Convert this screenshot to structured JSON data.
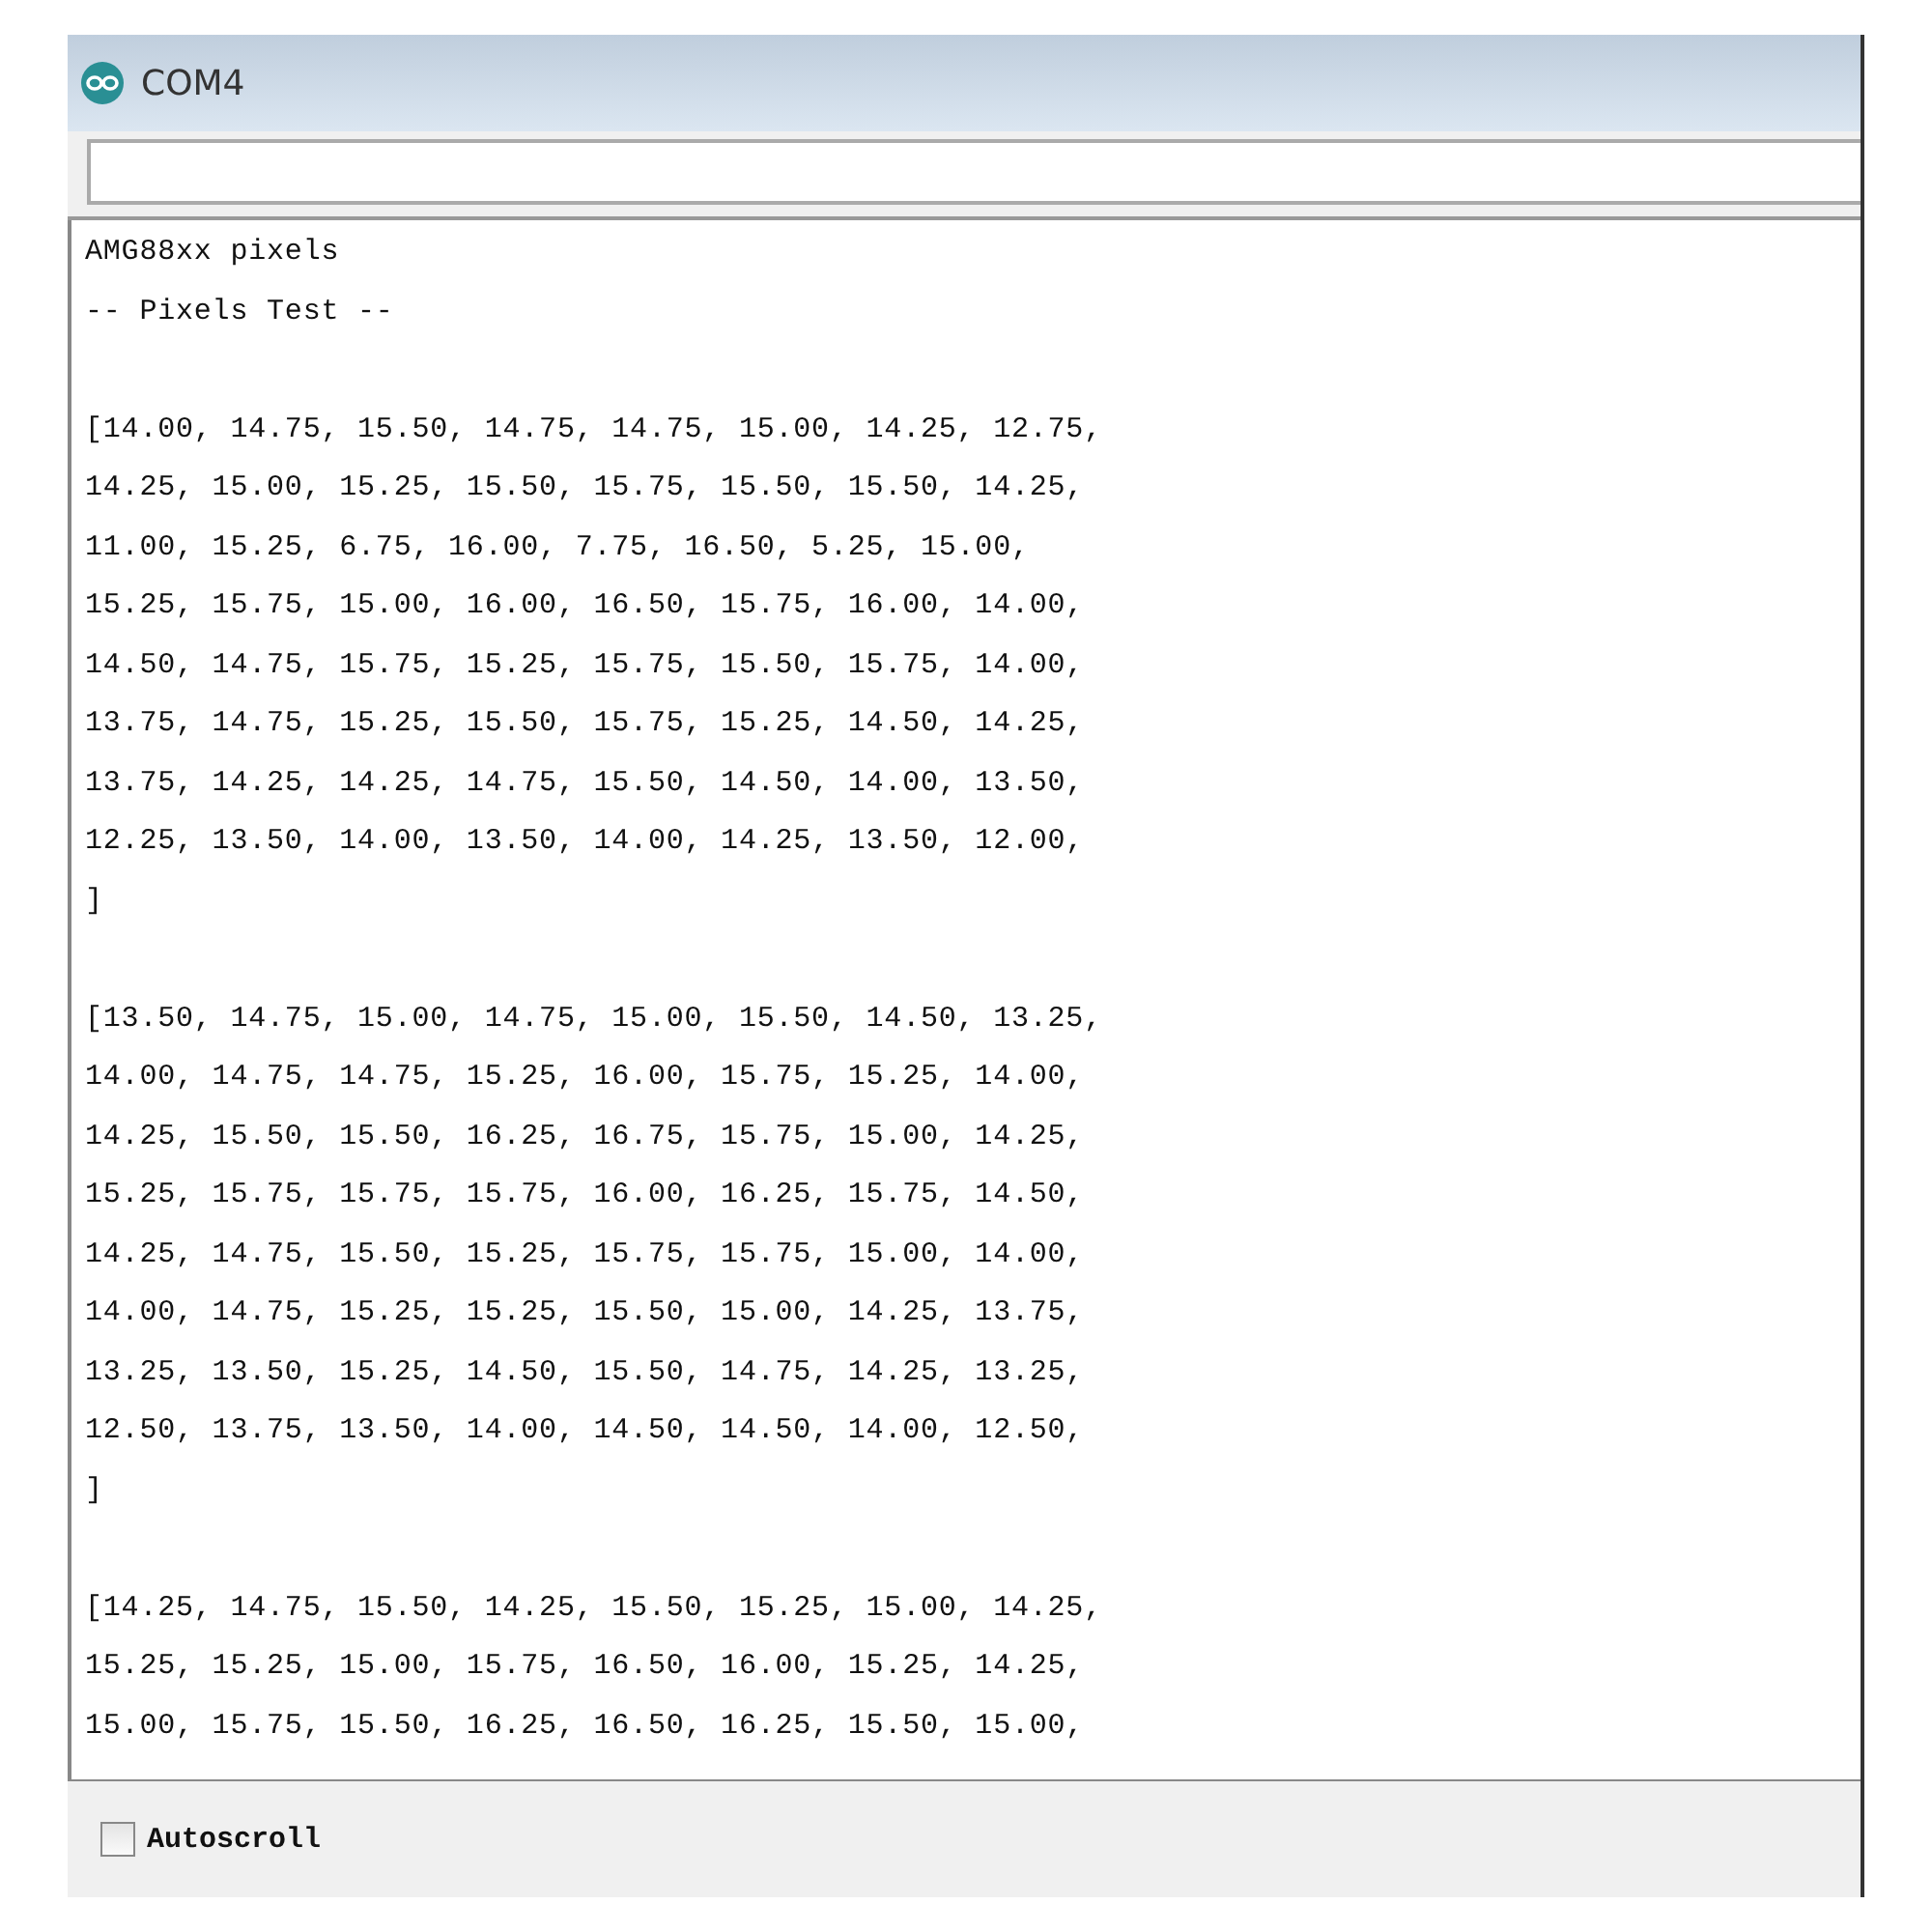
{
  "window": {
    "title": "COM4"
  },
  "output": {
    "blocks": [
      [
        "AMG88xx pixels",
        "-- Pixels Test --"
      ],
      [
        "[14.00, 14.75, 15.50, 14.75, 14.75, 15.00, 14.25, 12.75,",
        "14.25, 15.00, 15.25, 15.50, 15.75, 15.50, 15.50, 14.25,",
        "11.00, 15.25, 6.75, 16.00, 7.75, 16.50, 5.25, 15.00,",
        "15.25, 15.75, 15.00, 16.00, 16.50, 15.75, 16.00, 14.00,",
        "14.50, 14.75, 15.75, 15.25, 15.75, 15.50, 15.75, 14.00,",
        "13.75, 14.75, 15.25, 15.50, 15.75, 15.25, 14.50, 14.25,",
        "13.75, 14.25, 14.25, 14.75, 15.50, 14.50, 14.00, 13.50,",
        "12.25, 13.50, 14.00, 13.50, 14.00, 14.25, 13.50, 12.00,",
        "]"
      ],
      [
        "[13.50, 14.75, 15.00, 14.75, 15.00, 15.50, 14.50, 13.25,",
        "14.00, 14.75, 14.75, 15.25, 16.00, 15.75, 15.25, 14.00,",
        "14.25, 15.50, 15.50, 16.25, 16.75, 15.75, 15.00, 14.25,",
        "15.25, 15.75, 15.75, 15.75, 16.00, 16.25, 15.75, 14.50,",
        "14.25, 14.75, 15.50, 15.25, 15.75, 15.75, 15.00, 14.00,",
        "14.00, 14.75, 15.25, 15.25, 15.50, 15.00, 14.25, 13.75,",
        "13.25, 13.50, 15.25, 14.50, 15.50, 14.75, 14.25, 13.25,",
        "12.50, 13.75, 13.50, 14.00, 14.50, 14.50, 14.00, 12.50,",
        "]"
      ],
      [
        "[14.25, 14.75, 15.50, 14.25, 15.50, 15.25, 15.00, 14.25,",
        "15.25, 15.25, 15.00, 15.75, 16.50, 16.00, 15.25, 14.25,",
        "15.00, 15.75, 15.50, 16.25, 16.50, 16.25, 15.50, 15.00,"
      ]
    ]
  },
  "autoscroll": {
    "label": "Autoscroll",
    "checked": false
  }
}
